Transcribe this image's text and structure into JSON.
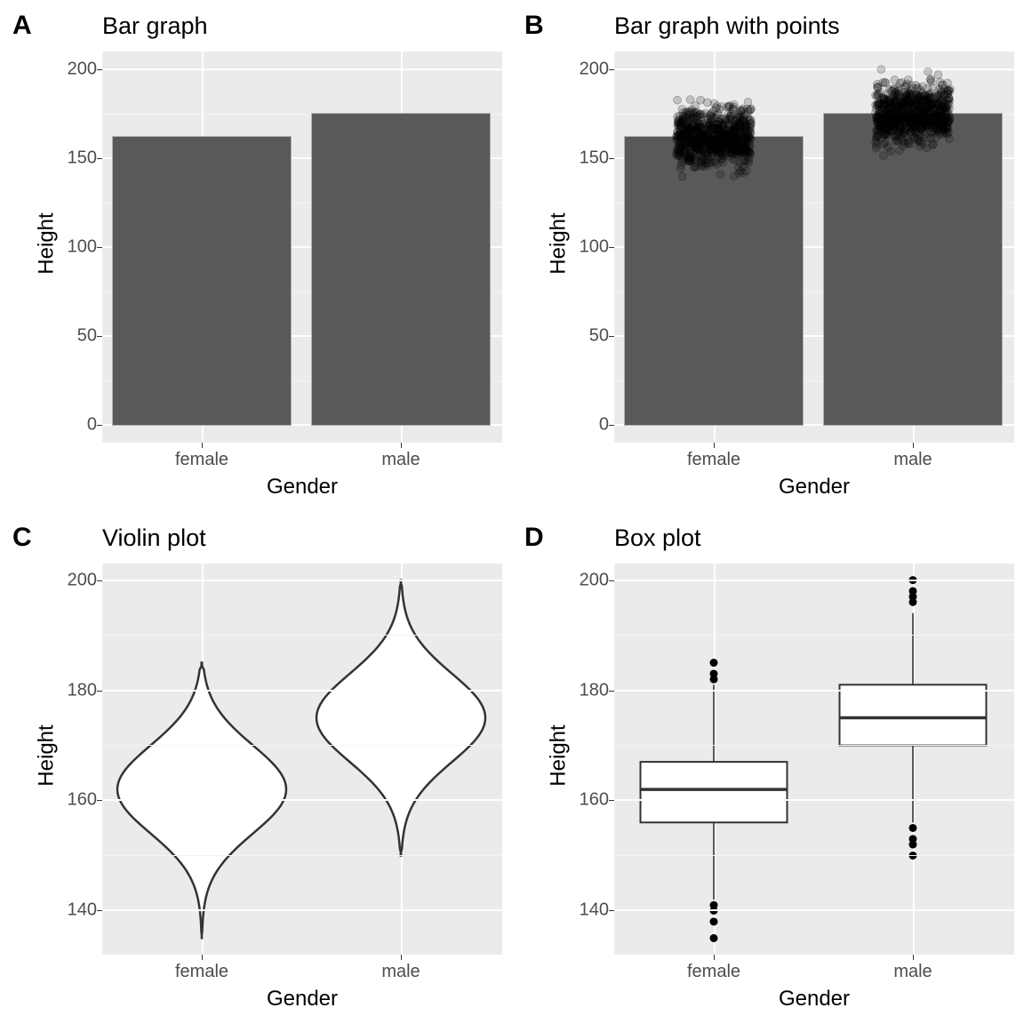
{
  "panels": {
    "A": {
      "tag": "A",
      "title": "Bar graph",
      "xlabel": "Gender",
      "ylabel": "Height"
    },
    "B": {
      "tag": "B",
      "title": "Bar graph with points",
      "xlabel": "Gender",
      "ylabel": "Height"
    },
    "C": {
      "tag": "C",
      "title": "Violin plot",
      "xlabel": "Gender",
      "ylabel": "Height"
    },
    "D": {
      "tag": "D",
      "title": "Box plot",
      "xlabel": "Gender",
      "ylabel": "Height"
    }
  },
  "axes": {
    "AB": {
      "yticks": [
        0,
        50,
        100,
        150,
        200
      ],
      "xticks": [
        "female",
        "male"
      ],
      "ylim": [
        -10,
        210
      ]
    },
    "CD": {
      "yticks": [
        140,
        160,
        180,
        200
      ],
      "xticks": [
        "female",
        "male"
      ],
      "ylim": [
        132,
        203
      ]
    }
  },
  "chart_data": [
    {
      "id": "A",
      "type": "bar",
      "title": "Bar graph",
      "categories": [
        "female",
        "male"
      ],
      "values": [
        162,
        175
      ],
      "xlabel": "Gender",
      "ylabel": "Height",
      "ylim": [
        0,
        210
      ]
    },
    {
      "id": "B",
      "type": "bar",
      "title": "Bar graph with points",
      "categories": [
        "female",
        "male"
      ],
      "values": [
        162,
        175
      ],
      "points": {
        "female": {
          "min": 135,
          "max": 185,
          "mean": 162,
          "sd": 8,
          "n": 800
        },
        "male": {
          "min": 150,
          "max": 200,
          "mean": 175,
          "sd": 8,
          "n": 800
        }
      },
      "xlabel": "Gender",
      "ylabel": "Height",
      "ylim": [
        0,
        210
      ]
    },
    {
      "id": "C",
      "type": "violin",
      "title": "Violin plot",
      "categories": [
        "female",
        "male"
      ],
      "series": [
        {
          "name": "female",
          "min": 135,
          "max": 185,
          "mean": 162,
          "sd": 8
        },
        {
          "name": "male",
          "min": 150,
          "max": 200,
          "mean": 175,
          "sd": 8
        }
      ],
      "xlabel": "Gender",
      "ylabel": "Height",
      "ylim": [
        132,
        203
      ]
    },
    {
      "id": "D",
      "type": "box",
      "title": "Box plot",
      "categories": [
        "female",
        "male"
      ],
      "series": [
        {
          "name": "female",
          "q1": 156,
          "median": 162,
          "q3": 167,
          "whisker_low": 142,
          "whisker_high": 181,
          "outliers": [
            135,
            138,
            140,
            141,
            182,
            183,
            185
          ]
        },
        {
          "name": "male",
          "q1": 170,
          "median": 175,
          "q3": 181,
          "whisker_low": 156,
          "whisker_high": 194,
          "outliers": [
            150,
            152,
            153,
            155,
            196,
            197,
            198,
            200
          ]
        }
      ],
      "xlabel": "Gender",
      "ylabel": "Height",
      "ylim": [
        132,
        203
      ]
    }
  ]
}
